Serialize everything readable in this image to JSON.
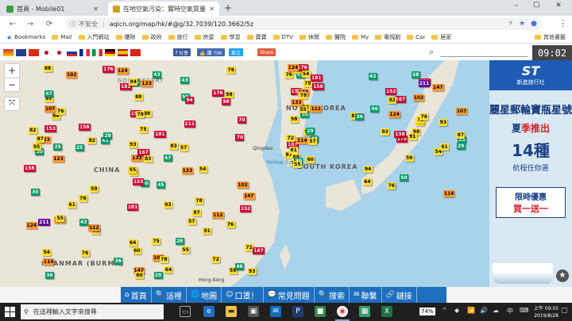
{
  "browser": {
    "tabs": [
      {
        "title": "首頁 - Mobile01",
        "favicon_color": "#3ca13c"
      },
      {
        "title": "在地空氣污染：實時空氣質量指數地圖",
        "favicon_color": "#c9a227"
      }
    ],
    "window_controls": {
      "minimize": "–",
      "maximize": "☐",
      "close": "✕"
    },
    "nav": {
      "back": "←",
      "forward": "→",
      "reload": "⟳"
    },
    "address": {
      "security_label": "不安全",
      "url": "aqicn.org/map/hk/#@g/32.7039/120.3662/5z"
    },
    "bookmarks": [
      {
        "label": "Bookmarks",
        "type": "star"
      },
      {
        "label": "Mail"
      },
      {
        "label": "入門網站"
      },
      {
        "label": "樓財"
      },
      {
        "label": "政府"
      },
      {
        "label": "旅行"
      },
      {
        "label": "房屋"
      },
      {
        "label": "學習"
      },
      {
        "label": "寶寶"
      },
      {
        "label": "DTV"
      },
      {
        "label": "休閒"
      },
      {
        "label": "醫院"
      },
      {
        "label": "My"
      },
      {
        "label": "電視劇"
      },
      {
        "label": "Car"
      },
      {
        "label": "居家"
      },
      {
        "label": "其他書籤"
      }
    ]
  },
  "site": {
    "share_buttons": [
      {
        "label": "f 分享",
        "color": "#3b5998"
      },
      {
        "label": "👍 讚 706",
        "color": "#4267b2"
      },
      {
        "label": "推文",
        "color": "#1da1f2"
      },
      {
        "label": "Share",
        "color": "#e05a3c"
      }
    ],
    "clock": "09:02",
    "map_labels": [
      {
        "text": "GOBI DESERT",
        "kind": "region"
      },
      {
        "text": "CHINA",
        "kind": "country"
      },
      {
        "text": "NORTH KOREA",
        "kind": "country"
      },
      {
        "text": "SOUTH KOREA",
        "kind": "country"
      },
      {
        "text": "Yellow Sea",
        "kind": "sea"
      },
      {
        "text": "MYANMAR (BURMA)",
        "kind": "country"
      },
      {
        "text": "Qingdao",
        "kind": "city"
      },
      {
        "text": "Hong Kong",
        "kind": "city"
      }
    ],
    "zoom": {
      "in": "+",
      "out": "−",
      "fullscreen": "⤧"
    },
    "menu": [
      {
        "icon": "⌂",
        "label": "首頁"
      },
      {
        "icon": "🔍",
        "label": "這裡"
      },
      {
        "icon": "🌐",
        "label": "地圖"
      },
      {
        "icon": "☺",
        "label": "口罩！"
      },
      {
        "icon": "💬",
        "label": "常見問題"
      },
      {
        "icon": "🔍",
        "label": "搜索"
      },
      {
        "icon": "✉",
        "label": "聯繫"
      },
      {
        "icon": "🔗",
        "label": "鏈接"
      }
    ]
  },
  "ad": {
    "brand_mark": "ST",
    "brand_name": "新進旅行社",
    "title": "麗星郵輪寶瓶星號",
    "subtitle_pre": "夏",
    "subtitle_kw": "季推出",
    "big": "14種",
    "small": "航程任你選",
    "promo_l1": "限時優惠",
    "promo_l2": "買一送一"
  },
  "taskbar": {
    "search_placeholder": "在這裡輸入文字來搜尋",
    "battery": "74%",
    "time": "上午 09:05",
    "date": "2019/8/28"
  },
  "aqi_colors": {
    "good": "#009966",
    "moderate": "#ffde33",
    "usg": "#ff9933",
    "unhealthy": "#cc0033",
    "very_unhealthy": "#660099"
  },
  "aqi_readings": [
    {
      "v": "50",
      "lvl": "good"
    },
    {
      "v": "94",
      "lvl": "mod"
    },
    {
      "v": "70",
      "lvl": "mod"
    },
    {
      "v": "87",
      "lvl": "mod"
    },
    {
      "v": "55",
      "lvl": "mod"
    },
    {
      "v": "61",
      "lvl": "mod"
    },
    {
      "v": "43",
      "lvl": "good"
    },
    {
      "v": "88",
      "lvl": "mod"
    },
    {
      "v": "75",
      "lvl": "mod"
    },
    {
      "v": "98",
      "lvl": "mod"
    },
    {
      "v": "102",
      "lvl": "usg"
    },
    {
      "v": "93",
      "lvl": "mod"
    },
    {
      "v": "123",
      "lvl": "usg"
    },
    {
      "v": "158",
      "lvl": "unh"
    },
    {
      "v": "176",
      "lvl": "unh"
    },
    {
      "v": "211",
      "lvl": "vunh"
    },
    {
      "v": "153",
      "lvl": "unh"
    },
    {
      "v": "181",
      "lvl": "unh"
    },
    {
      "v": "167",
      "lvl": "unh"
    },
    {
      "v": "124",
      "lvl": "usg"
    },
    {
      "v": "114",
      "lvl": "usg"
    },
    {
      "v": "76",
      "lvl": "mod"
    },
    {
      "v": "78",
      "lvl": "mod"
    },
    {
      "v": "82",
      "lvl": "mod"
    },
    {
      "v": "54",
      "lvl": "mod"
    },
    {
      "v": "76",
      "lvl": "mod"
    },
    {
      "v": "46",
      "lvl": "good"
    },
    {
      "v": "30",
      "lvl": "good"
    },
    {
      "v": "93",
      "lvl": "mod"
    },
    {
      "v": "107",
      "lvl": "usg"
    },
    {
      "v": "55",
      "lvl": "mod"
    },
    {
      "v": "64",
      "lvl": "mod"
    },
    {
      "v": "133",
      "lvl": "usg"
    },
    {
      "v": "152",
      "lvl": "unh"
    },
    {
      "v": "147",
      "lvl": "usg"
    },
    {
      "v": "112",
      "lvl": "usg"
    },
    {
      "v": "59",
      "lvl": "mod"
    },
    {
      "v": "72",
      "lvl": "mod"
    },
    {
      "v": "29",
      "lvl": "good"
    },
    {
      "v": "28",
      "lvl": "good"
    },
    {
      "v": "45",
      "lvl": "good"
    },
    {
      "v": "25",
      "lvl": "good"
    },
    {
      "v": "57",
      "lvl": "mod"
    },
    {
      "v": "91",
      "lvl": "mod"
    },
    {
      "v": "83",
      "lvl": "mod"
    },
    {
      "v": "47",
      "lvl": "good"
    },
    {
      "v": "36",
      "lvl": "good"
    },
    {
      "v": "60",
      "lvl": "mod"
    }
  ]
}
